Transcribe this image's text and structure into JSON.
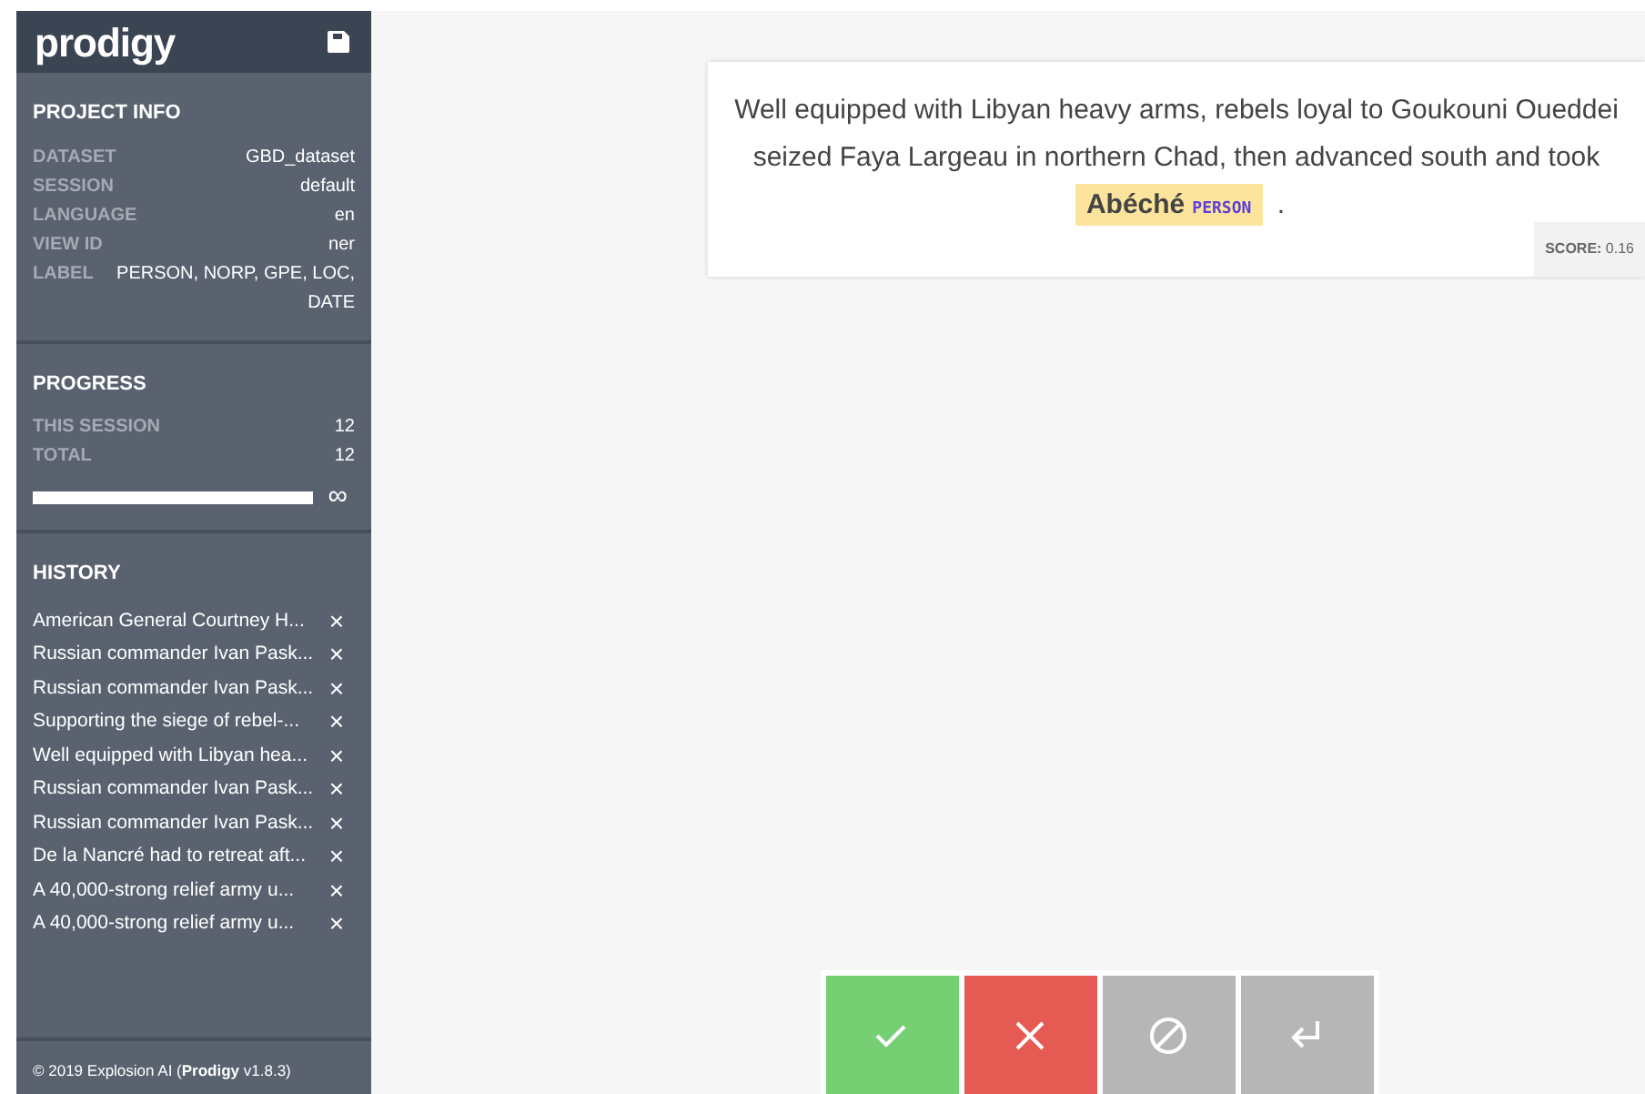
{
  "sidebar": {
    "logo": "prodigy",
    "project_info": {
      "title": "PROJECT INFO",
      "rows": [
        {
          "label": "DATASET",
          "value": "GBD_dataset"
        },
        {
          "label": "SESSION",
          "value": "default"
        },
        {
          "label": "LANGUAGE",
          "value": "en"
        },
        {
          "label": "VIEW ID",
          "value": "ner"
        },
        {
          "label": "LABEL",
          "value": "PERSON, NORP, GPE, LOC, DATE"
        }
      ]
    },
    "progress": {
      "title": "PROGRESS",
      "rows": [
        {
          "label": "THIS SESSION",
          "value": "12"
        },
        {
          "label": "TOTAL",
          "value": "12"
        }
      ],
      "level": 1,
      "total_symbol": "∞"
    },
    "history": {
      "title": "HISTORY",
      "items": [
        {
          "text": "American General Courtney H...",
          "remove": "×"
        },
        {
          "text": "Russian commander Ivan Pask...",
          "remove": "×"
        },
        {
          "text": "Russian commander Ivan Pask...",
          "remove": "×"
        },
        {
          "text": "Supporting the siege of rebel-...",
          "remove": "×"
        },
        {
          "text": "Well equipped with Libyan hea...",
          "remove": "×"
        },
        {
          "text": "Russian commander Ivan Pask...",
          "remove": "×"
        },
        {
          "text": "Russian commander Ivan Pask...",
          "remove": "×"
        },
        {
          "text": "De la Nancré had to retreat aft...",
          "remove": "×"
        },
        {
          "text": "A 40,000-strong relief army u...",
          "remove": "×"
        },
        {
          "text": "A 40,000-strong relief army u...",
          "remove": "×"
        }
      ]
    },
    "footer": "© 2019 Explosion AI (**Prodigy** v1.8.3)"
  },
  "task": {
    "segments": [
      {
        "kind": "text",
        "text": "Well equipped with Libyan heavy arms, rebels loyal to Goukouni Oueddei seized Faya Largeau in northern Chad, then advanced south and took "
      },
      {
        "kind": "entity",
        "text": "Abéché",
        "label": "PERSON"
      },
      {
        "kind": "text",
        "text": " ."
      }
    ],
    "score_label": "SCORE:",
    "score": "0.16"
  },
  "actions": [
    {
      "kind": "accept"
    },
    {
      "kind": "reject"
    },
    {
      "kind": "ignore"
    },
    {
      "kind": "undo"
    }
  ]
}
